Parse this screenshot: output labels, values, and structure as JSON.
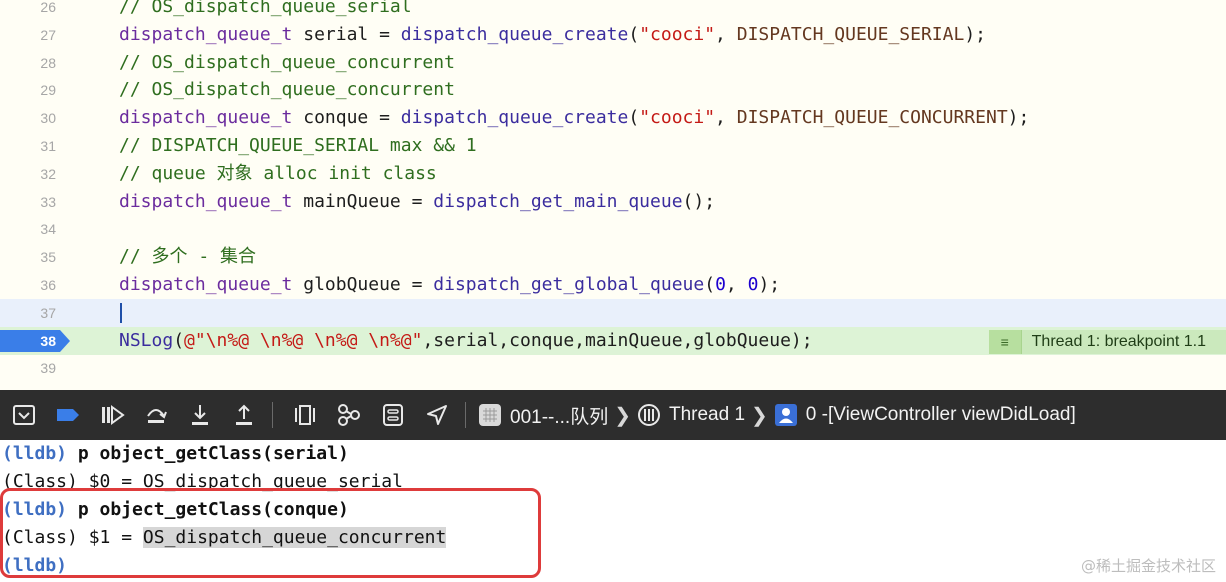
{
  "editor": {
    "lines": [
      {
        "num": "26",
        "parts": [
          {
            "t": "// OS_dispatch_queue_serial",
            "c": "cm"
          }
        ]
      },
      {
        "num": "27",
        "parts": [
          {
            "t": "dispatch_queue_t",
            "c": "ty"
          },
          {
            "t": " serial = ",
            "c": ""
          },
          {
            "t": "dispatch_queue_create",
            "c": "fn"
          },
          {
            "t": "(",
            "c": ""
          },
          {
            "t": "\"cooci\"",
            "c": "st"
          },
          {
            "t": ", ",
            "c": ""
          },
          {
            "t": "DISPATCH_QUEUE_SERIAL",
            "c": "mc"
          },
          {
            "t": ");",
            "c": ""
          }
        ]
      },
      {
        "num": "28",
        "parts": [
          {
            "t": "// OS_dispatch_queue_concurrent",
            "c": "cm"
          }
        ]
      },
      {
        "num": "29",
        "parts": [
          {
            "t": "// OS_dispatch_queue_concurrent",
            "c": "cm"
          }
        ]
      },
      {
        "num": "30",
        "parts": [
          {
            "t": "dispatch_queue_t",
            "c": "ty"
          },
          {
            "t": " conque = ",
            "c": ""
          },
          {
            "t": "dispatch_queue_create",
            "c": "fn"
          },
          {
            "t": "(",
            "c": ""
          },
          {
            "t": "\"cooci\"",
            "c": "st"
          },
          {
            "t": ", ",
            "c": ""
          },
          {
            "t": "DISPATCH_QUEUE_CONCURRENT",
            "c": "mc"
          },
          {
            "t": ");",
            "c": ""
          }
        ]
      },
      {
        "num": "31",
        "parts": [
          {
            "t": "// DISPATCH_QUEUE_SERIAL max && 1",
            "c": "cm"
          }
        ]
      },
      {
        "num": "32",
        "parts": [
          {
            "t": "// queue 对象 alloc init class",
            "c": "cm"
          }
        ]
      },
      {
        "num": "33",
        "parts": [
          {
            "t": "dispatch_queue_t",
            "c": "ty"
          },
          {
            "t": " mainQueue = ",
            "c": ""
          },
          {
            "t": "dispatch_get_main_queue",
            "c": "fn"
          },
          {
            "t": "();",
            "c": ""
          }
        ]
      },
      {
        "num": "34",
        "parts": []
      },
      {
        "num": "35",
        "parts": [
          {
            "t": "// 多个 - 集合",
            "c": "cm"
          }
        ]
      },
      {
        "num": "36",
        "parts": [
          {
            "t": "dispatch_queue_t",
            "c": "ty"
          },
          {
            "t": " globQueue = ",
            "c": ""
          },
          {
            "t": "dispatch_get_global_queue",
            "c": "fn"
          },
          {
            "t": "(",
            "c": ""
          },
          {
            "t": "0",
            "c": "nm"
          },
          {
            "t": ", ",
            "c": ""
          },
          {
            "t": "0",
            "c": "nm"
          },
          {
            "t": ");",
            "c": ""
          }
        ]
      },
      {
        "num": "37",
        "parts": [],
        "current": true
      },
      {
        "num": "38",
        "parts": [
          {
            "t": "NSLog",
            "c": "fn"
          },
          {
            "t": "(",
            "c": ""
          },
          {
            "t": "@\"\\n%@ \\n%@ \\n%@ \\n%@\"",
            "c": "st"
          },
          {
            "t": ",serial,conque,mainQueue,globQueue);",
            "c": ""
          }
        ],
        "breakpoint": true
      },
      {
        "num": "39",
        "parts": []
      }
    ],
    "thread_badge": "Thread 1: breakpoint 1.1",
    "thread_badge_icon": "hamburger-icon"
  },
  "debug_bar": {
    "buttons": [
      "hide-console-icon",
      "breakpoint-toggle-icon",
      "continue-icon",
      "step-over-icon",
      "step-into-icon",
      "step-out-icon",
      "view-debugger-icon",
      "memory-graph-icon",
      "environment-overrides-icon",
      "simulate-location-icon"
    ],
    "target_name": "001--...队列",
    "thread_label": "Thread 1",
    "frame_label": "0 -[ViewController viewDidLoad]",
    "colors": {
      "background": "#2d2d2d",
      "accent": "#3a7ee8"
    }
  },
  "console": {
    "prompt": "(lldb)",
    "cmd1": "p object_getClass(serial)",
    "out1_prefix": "(Class) $0 = ",
    "out1_value": "OS_dispatch_queue_serial",
    "cmd2": "p object_getClass(conque)",
    "out2_prefix": "(Class) $1 = ",
    "out2_value": "OS_dispatch_queue_concurrent"
  },
  "watermark": "@稀土掘金技术社区"
}
